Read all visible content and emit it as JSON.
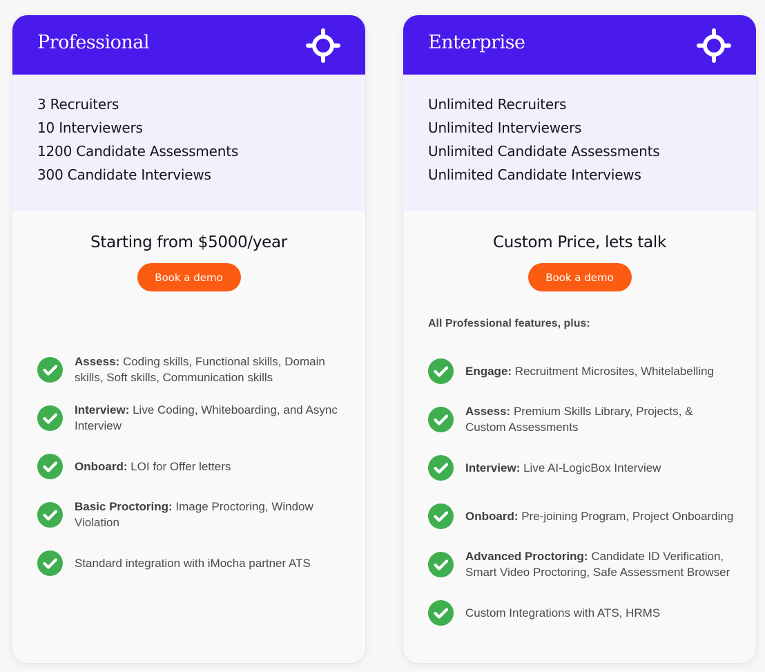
{
  "colors": {
    "header_bg": "#4a19ec",
    "quota_bg": "#f1f0fd",
    "button_bg": "#fc5b12",
    "check_green": "#3fae4f"
  },
  "plans": [
    {
      "name": "Professional",
      "icon": "target-icon",
      "quota": [
        "3 Recruiters",
        "10 Interviewers",
        "1200 Candidate Assessments",
        "300 Candidate Interviews"
      ],
      "price": "Starting from $5000/year",
      "button_label": "Book a demo",
      "features": [
        {
          "title": "Assess:",
          "text": " Coding skills, Functional skills, Domain skills, Soft skills, Communication skills"
        },
        {
          "title": "Interview:",
          "text": " Live Coding, Whiteboarding, and Async Interview"
        },
        {
          "title": "Onboard:",
          "text": " LOI for Offer letters"
        },
        {
          "title": "Basic Proctoring:",
          "text": " Image Proctoring, Window Violation"
        },
        {
          "title": "",
          "text": "Standard integration with iMocha partner ATS"
        }
      ]
    },
    {
      "name": "Enterprise",
      "icon": "target-icon",
      "quota": [
        "Unlimited Recruiters",
        "Unlimited Interviewers",
        "Unlimited Candidate Assessments",
        "Unlimited Candidate Interviews"
      ],
      "price": "Custom Price, lets talk",
      "button_label": "Book a demo",
      "plus_note": "All Professional features, plus:",
      "features": [
        {
          "title": "Engage:",
          "text": " Recruitment Microsites, Whitelabelling"
        },
        {
          "title": "Assess:",
          "text": " Premium Skills Library, Projects, & Custom Assessments"
        },
        {
          "title": "Interview:",
          "text": " Live AI-LogicBox Interview"
        },
        {
          "title": "Onboard:",
          "text": " Pre-joining Program, Project Onboarding"
        },
        {
          "title": "Advanced Proctoring:",
          "text": " Candidate ID Verification, Smart Video Proctoring, Safe Assessment Browser"
        },
        {
          "title": "",
          "text": "Custom Integrations with ATS, HRMS"
        }
      ]
    }
  ]
}
